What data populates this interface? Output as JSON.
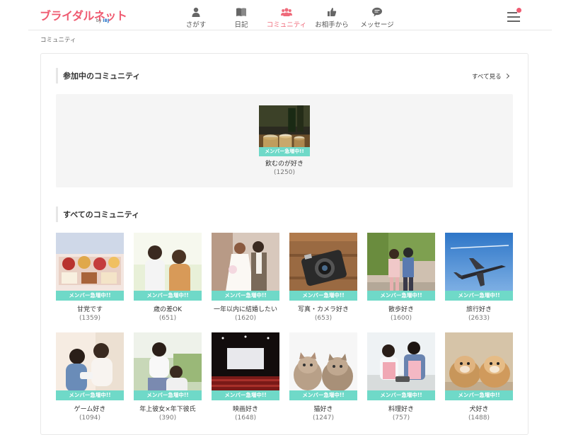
{
  "header": {
    "logo_text": "ブライダルネット",
    "logo_sub_prefix": "by",
    "logo_sub_brand": "IBJ",
    "nav": [
      {
        "id": "search",
        "label": "さがす",
        "icon": "person-icon",
        "active": false
      },
      {
        "id": "diary",
        "label": "日記",
        "icon": "book-icon",
        "active": false
      },
      {
        "id": "community",
        "label": "コミュニティ",
        "icon": "group-icon",
        "active": true
      },
      {
        "id": "from-partner",
        "label": "お相手から",
        "icon": "thumbs-up-icon",
        "active": false
      },
      {
        "id": "message",
        "label": "メッセージ",
        "icon": "chat-bubble-icon",
        "active": false
      }
    ],
    "menu_icon": "hamburger-icon",
    "accent_color": "#ef5b71"
  },
  "breadcrumb": "コミュニティ",
  "joined": {
    "title": "参加中のコミュニティ",
    "see_all": "すべて見る",
    "items": [
      {
        "name": "飲むのが好き",
        "count": "(1250)",
        "badge": "メンバー急増中!!",
        "art": "drinks"
      }
    ]
  },
  "all": {
    "title": "すべてのコミュニティ",
    "items": [
      {
        "name": "甘党です",
        "count": "(1359)",
        "badge": "メンバー急増中!!",
        "art": "cakes"
      },
      {
        "name": "歳の差OK",
        "count": "(651)",
        "badge": "メンバー急増中!!",
        "art": "couple-back"
      },
      {
        "name": "一年以内に結婚したい",
        "count": "(1620)",
        "badge": "メンバー急増中!!",
        "art": "wedding"
      },
      {
        "name": "写真・カメラ好き",
        "count": "(653)",
        "badge": "メンバー急増中!!",
        "art": "camera"
      },
      {
        "name": "散歩好き",
        "count": "(1600)",
        "badge": "メンバー急増中!!",
        "art": "walk"
      },
      {
        "name": "旅行好き",
        "count": "(2633)",
        "badge": "メンバー急増中!!",
        "art": "airplane"
      },
      {
        "name": "ゲーム好き",
        "count": "(1094)",
        "badge": "メンバー急増中!!",
        "art": "game"
      },
      {
        "name": "年上彼女×年下彼氏",
        "count": "(390)",
        "badge": "メンバー急増中!!",
        "art": "park"
      },
      {
        "name": "映画好き",
        "count": "(1648)",
        "badge": "メンバー急増中!!",
        "art": "theater"
      },
      {
        "name": "猫好き",
        "count": "(1247)",
        "badge": "メンバー急増中!!",
        "art": "cats"
      },
      {
        "name": "料理好き",
        "count": "(757)",
        "badge": "メンバー急増中!!",
        "art": "cooking"
      },
      {
        "name": "犬好き",
        "count": "(1488)",
        "badge": "メンバー急増中!!",
        "art": "puppies"
      }
    ]
  },
  "colors": {
    "badge": "#6fd9c8",
    "active_nav": "#ef6b7b",
    "panel": "#f5f5f5"
  }
}
